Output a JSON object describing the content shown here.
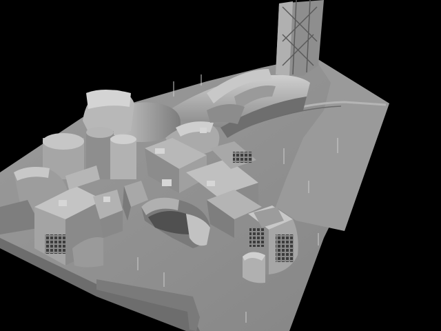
{
  "scene": {
    "subject": "",
    "colors": {
      "background": "#000000",
      "ground": "#8e8e8e",
      "ground_dark": "#6f6f6f",
      "building_light": "#b9b9b9",
      "building_mid": "#a3a3a3",
      "building_dark": "#6a6a6a",
      "window_dark": "#3a3a3a",
      "tower": "#9a9a9a"
    }
  }
}
